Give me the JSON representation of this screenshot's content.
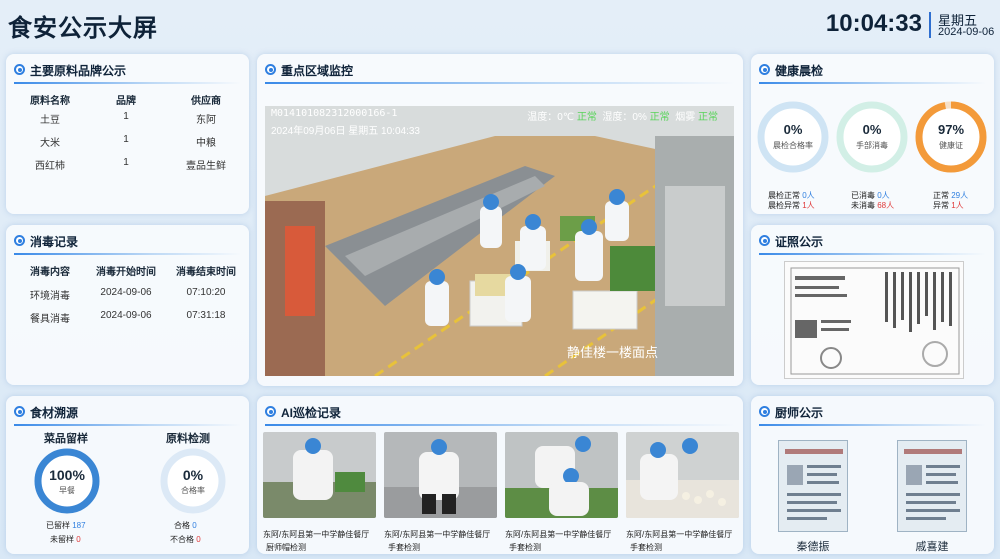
{
  "header": {
    "title": "食安公示大屏",
    "time": "10:04:33",
    "weekday": "星期五",
    "date": "2024-09-06"
  },
  "materials": {
    "title": "主要原料品牌公示",
    "columns": [
      "原料名称",
      "品牌",
      "供应商"
    ],
    "rows": [
      [
        "土豆",
        "1",
        "东阿"
      ],
      [
        "大米",
        "1",
        "中粮"
      ],
      [
        "西红柿",
        "1",
        "壹品生鲜"
      ]
    ]
  },
  "disinfect": {
    "title": "消毒记录",
    "columns": [
      "消毒内容",
      "消毒开始时间",
      "消毒结束时间"
    ],
    "rows": [
      [
        "环境消毒",
        "2024-09-06",
        "07:10:20"
      ],
      [
        "餐具消毒",
        "2024-09-06",
        "07:31:18"
      ]
    ]
  },
  "traceability": {
    "title": "食材溯源",
    "sample": {
      "heading": "菜品留样",
      "value": "100%",
      "label": "早餐",
      "fraction": 1.0,
      "kept_label": "已留样",
      "kept": "187",
      "notkept_label": "未留样",
      "notkept": "0"
    },
    "inspect": {
      "heading": "原料检测",
      "value": "0%",
      "label": "合格率",
      "fraction": 0,
      "pass_label": "合格",
      "pass": "0",
      "fail_label": "不合格",
      "fail": "0"
    }
  },
  "monitor": {
    "title": "重点区域监控",
    "cam_id": "M014101082312000166-1",
    "cam_datetime": "2024年09月06日  星期五  10:04:33",
    "temp_label": "温度：",
    "temp_value": "0℃",
    "temp_status": "正常",
    "humid_label": "湿度：",
    "humid_value": "0%",
    "humid_status": "正常",
    "smoke_label": "烟雾",
    "smoke_status": "正常",
    "location": "静佳楼一楼面点"
  },
  "health": {
    "title": "健康晨检",
    "rings": [
      {
        "value": "0%",
        "label": "晨检合格率",
        "fraction": 0,
        "color": "#cfe4f4"
      },
      {
        "value": "0%",
        "label": "手部消毒",
        "fraction": 0,
        "color": "#d2efe6"
      },
      {
        "value": "97%",
        "label": "健康证",
        "fraction": 0.97,
        "color": "#f39a3a"
      }
    ],
    "stats": [
      {
        "l1": "晨检正常",
        "v1": "0人",
        "l2": "晨检异常",
        "v2": "1人"
      },
      {
        "l1": "已消毒",
        "v1": "0人",
        "l2": "未消毒",
        "v2": "68人"
      },
      {
        "l1": "正常",
        "v1": "29人",
        "l2": "异常",
        "v2": "1人"
      }
    ]
  },
  "license": {
    "title": "证照公示"
  },
  "ai": {
    "title": "AI巡检记录",
    "items": [
      {
        "caption": "东阿/东阿县第一中学静佳餐厅",
        "tag": "厨师帽检测"
      },
      {
        "caption": "东阿/东阿县第一中学静佳餐厅",
        "tag": "手套检测"
      },
      {
        "caption": "东阿/东阿县第一中学静佳餐厅",
        "tag": "手套检测"
      },
      {
        "caption": "东阿/东阿县第一中学静佳餐厅",
        "tag": "手套检测"
      }
    ]
  },
  "chefs": {
    "title": "厨师公示",
    "names": [
      "秦德振",
      "戚喜建"
    ]
  }
}
